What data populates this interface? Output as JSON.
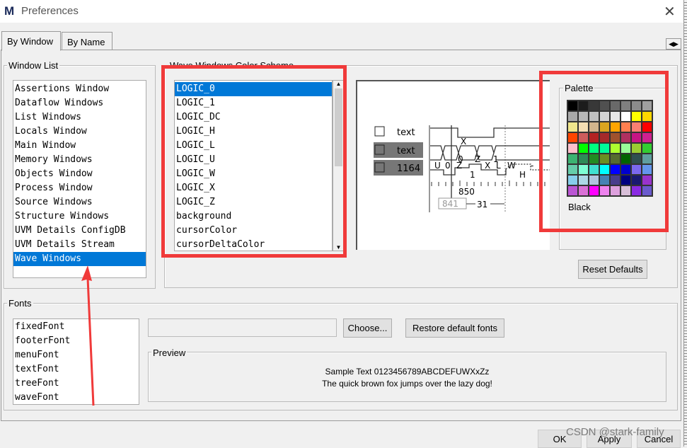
{
  "window": {
    "title": "Preferences",
    "logo": "M",
    "close_icon": "close-icon"
  },
  "tabs": [
    {
      "label": "By Window",
      "active": true
    },
    {
      "label": "By Name",
      "active": false
    }
  ],
  "window_list": {
    "label": "Window List",
    "items": [
      "Assertions Window",
      "Dataflow Windows",
      "List Windows",
      "Locals Window",
      "Main Window",
      "Memory Windows",
      "Objects Window",
      "Process Window",
      "Source Windows",
      "Structure Windows",
      "UVM Details ConfigDB",
      "UVM Details Stream",
      "Wave Windows"
    ],
    "selected": "Wave Windows"
  },
  "color_scheme": {
    "label": "Wave Windows Color Scheme",
    "items": [
      "LOGIC_0",
      "LOGIC_1",
      "LOGIC_DC",
      "LOGIC_H",
      "LOGIC_L",
      "LOGIC_U",
      "LOGIC_W",
      "LOGIC_X",
      "LOGIC_Z",
      "background",
      "cursorColor",
      "cursorDeltaColor"
    ],
    "selected": "LOGIC_0"
  },
  "wave_preview": {
    "signals": [
      "text",
      "text",
      "1164"
    ],
    "bus1": [
      "X",
      "0",
      "Z",
      "1"
    ],
    "bus2": [
      "U",
      "0",
      "Z",
      "X",
      "L",
      "W",
      "-"
    ],
    "labels": {
      "one": "1",
      "h": "H",
      "time": "850",
      "cursor": "841",
      "delta": "31"
    }
  },
  "palette": {
    "label": "Palette",
    "selected_name": "Black",
    "colors": [
      "#000000",
      "#1c1c1c",
      "#383838",
      "#505050",
      "#696969",
      "#808080",
      "#8c8c8c",
      "#a0a0a0",
      "#a9a9a9",
      "#b8b8b8",
      "#c0c0c0",
      "#d3d3d3",
      "#e8e8e8",
      "#ffffff",
      "#ffff00",
      "#ffd700",
      "#f0e68c",
      "#f5deb3",
      "#d2b48c",
      "#daa520",
      "#ffa500",
      "#ff7f50",
      "#fa8072",
      "#ff0000",
      "#ff4500",
      "#cd5c5c",
      "#b22222",
      "#a52a2a",
      "#a0522d",
      "#b03060",
      "#c71585",
      "#d02090",
      "#ffc0cb",
      "#00ff00",
      "#00ff7f",
      "#00fa9a",
      "#adff2f",
      "#98fb98",
      "#9acd32",
      "#32cd32",
      "#3cb371",
      "#2e8b57",
      "#228b22",
      "#6b8e23",
      "#556b2f",
      "#006400",
      "#2f4f4f",
      "#5f9ea0",
      "#66cdaa",
      "#7fffd4",
      "#40e0d0",
      "#00ffff",
      "#0000ff",
      "#0000cd",
      "#7b68ee",
      "#6495ed",
      "#87ceeb",
      "#add8e6",
      "#b0c4de",
      "#4682b4",
      "#483d8b",
      "#000080",
      "#191970",
      "#9932cc",
      "#ba55d3",
      "#da70d6",
      "#ff00ff",
      "#ee82ee",
      "#dda0dd",
      "#d8bfd8",
      "#8a2be2",
      "#6a5acd"
    ]
  },
  "reset_defaults": "Reset Defaults",
  "fonts": {
    "label": "Fonts",
    "items": [
      "fixedFont",
      "footerFont",
      "menuFont",
      "textFont",
      "treeFont",
      "waveFont"
    ],
    "font_value": "",
    "choose": "Choose...",
    "restore": "Restore default fonts",
    "preview_label": "Preview",
    "sample1": "Sample Text 0123456789ABCDEFUWXxZz",
    "sample2": "The quick brown fox jumps over the lazy dog!"
  },
  "buttons": {
    "ok": "OK",
    "apply": "Apply",
    "cancel": "Cancel"
  },
  "watermark": "CSDN @stark-family",
  "annotation_color": "#f03a3a"
}
